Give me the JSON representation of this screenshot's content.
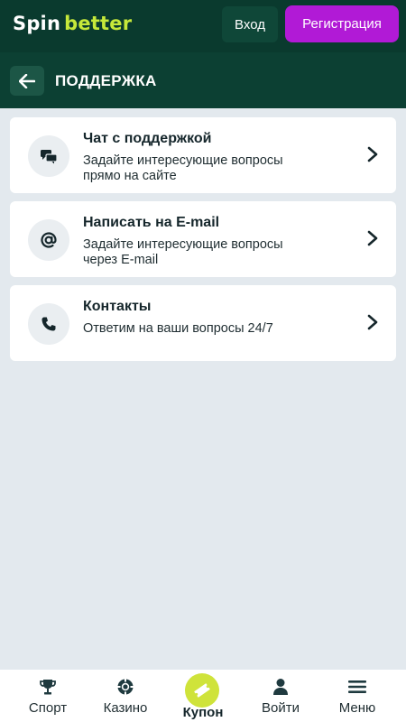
{
  "header": {
    "logo_spin": "Spin",
    "logo_better": "better",
    "login_label": "Вход",
    "register_label": "Регистрация"
  },
  "titlebar": {
    "back_icon": "arrow-left-icon",
    "title": "ПОДДЕРЖКА"
  },
  "cards": [
    {
      "icon": "chat-bubbles-icon",
      "title": "Чат с поддержкой",
      "subtitle_line1": "Задайте интересующие вопросы",
      "subtitle_line2": "прямо на сайте"
    },
    {
      "icon": "at-sign-icon",
      "title": "Написать на E-mail",
      "subtitle_line1": "Задайте интересующие вопросы",
      "subtitle_line2": "через E-mail"
    },
    {
      "icon": "phone-icon",
      "title": "Контакты",
      "subtitle_line1": "Ответим на ваши вопросы 24/7",
      "subtitle_line2": ""
    }
  ],
  "bottom_nav": [
    {
      "icon": "trophy-icon",
      "label": "Спорт"
    },
    {
      "icon": "casino-chip-icon",
      "label": "Казино"
    },
    {
      "icon": "coupon-ticket-icon",
      "label": "Купон"
    },
    {
      "icon": "user-icon",
      "label": "Войти"
    },
    {
      "icon": "menu-icon",
      "label": "Меню"
    }
  ],
  "colors": {
    "header_bg": "#0a3a2e",
    "titlebar_bg": "#0c4033",
    "accent_lime": "#c6e83a",
    "register_purple": "#b11ad6",
    "page_bg": "#e3e9ee"
  }
}
